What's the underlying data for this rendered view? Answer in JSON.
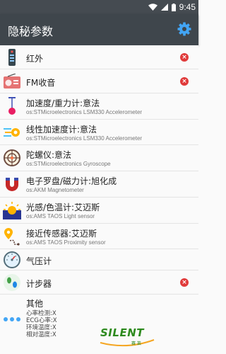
{
  "status_bar": {
    "time": "9:45"
  },
  "app_bar": {
    "title": "隐秘参数"
  },
  "items": [
    {
      "title": "红外",
      "subtitle": "",
      "icon": "infrared-remote-icon",
      "removable": true
    },
    {
      "title": "FM收音",
      "subtitle": "",
      "icon": "radio-icon",
      "removable": true
    },
    {
      "title": "加速度/重力计:意法",
      "subtitle": "os:STMicroelectronics LSM330 Accelerometer",
      "icon": "pendulum-icon",
      "removable": false
    },
    {
      "title": "线性加速度计:意法",
      "subtitle": "os:STMicroelectronics LSM330 Accelerometer",
      "icon": "speed-lines-icon",
      "removable": false
    },
    {
      "title": "陀螺仪:意法",
      "subtitle": "os:STMicroelectronics Gyroscope",
      "icon": "gyroscope-icon",
      "removable": false
    },
    {
      "title": "电子罗盘/磁力计:旭化成",
      "subtitle": "os:AKM Magnetometer",
      "icon": "magnet-icon",
      "removable": false
    },
    {
      "title": "光感/色温计:艾迈斯",
      "subtitle": "os:AMS TAOS Light sensor",
      "icon": "sun-horizon-icon",
      "removable": false
    },
    {
      "title": "接近传感器:艾迈斯",
      "subtitle": "os:AMS TAOS Proximity sensor",
      "icon": "location-pin-icon",
      "removable": false
    },
    {
      "title": "气压计",
      "subtitle": "",
      "icon": "barometer-icon",
      "removable": false
    },
    {
      "title": "计步器",
      "subtitle": "",
      "icon": "footprints-icon",
      "removable": true
    }
  ],
  "other": {
    "title": "其他",
    "icon": "dots-icon",
    "lines": [
      "心率检测:X",
      "ECG心率:X",
      "环境温度:X",
      "相对温度:X"
    ]
  },
  "colors": {
    "status_bar": "#454b51",
    "app_bar": "#3f464c",
    "remove": "#e03a3a",
    "accent": "#2196f3"
  },
  "watermark": {
    "brand": "SILENT",
    "sub": "赛 莱"
  }
}
